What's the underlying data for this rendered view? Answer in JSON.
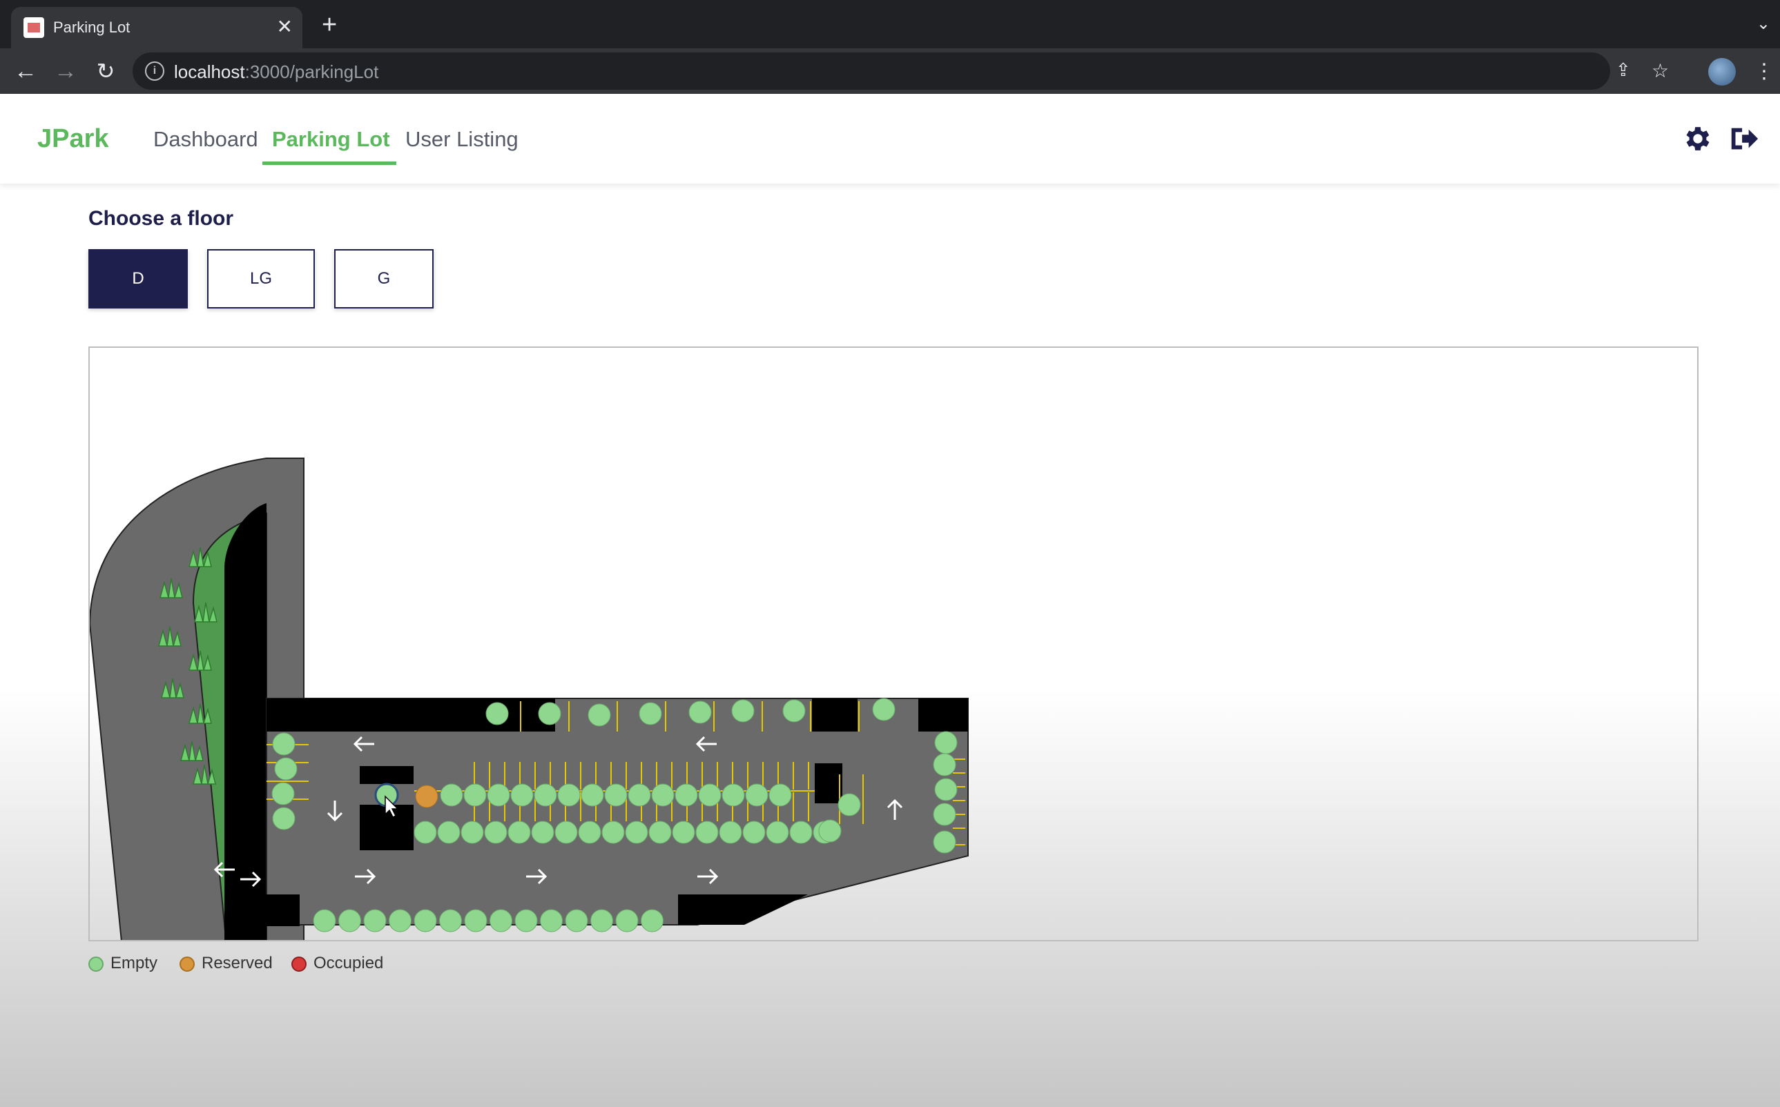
{
  "browser": {
    "tab_title": "Parking Lot",
    "url_host": "localhost",
    "url_path": ":3000/parkingLot"
  },
  "app": {
    "brand": "JPark",
    "nav": [
      "Dashboard",
      "Parking Lot",
      "User Listing"
    ],
    "active_nav": "Parking Lot",
    "accent_color": "#5cb85c",
    "primary_color": "#1f1f4e"
  },
  "floor_picker": {
    "heading": "Choose a floor",
    "floors": [
      "D",
      "LG",
      "G"
    ],
    "selected": "D"
  },
  "map": {
    "spot_counts": {
      "empty": 76,
      "reserved": 1,
      "occupied": 0
    }
  },
  "legend": [
    {
      "label": "Empty",
      "color": "#8fd68f"
    },
    {
      "label": "Reserved",
      "color": "#d9953b"
    },
    {
      "label": "Occupied",
      "color": "#d83a3a"
    }
  ]
}
